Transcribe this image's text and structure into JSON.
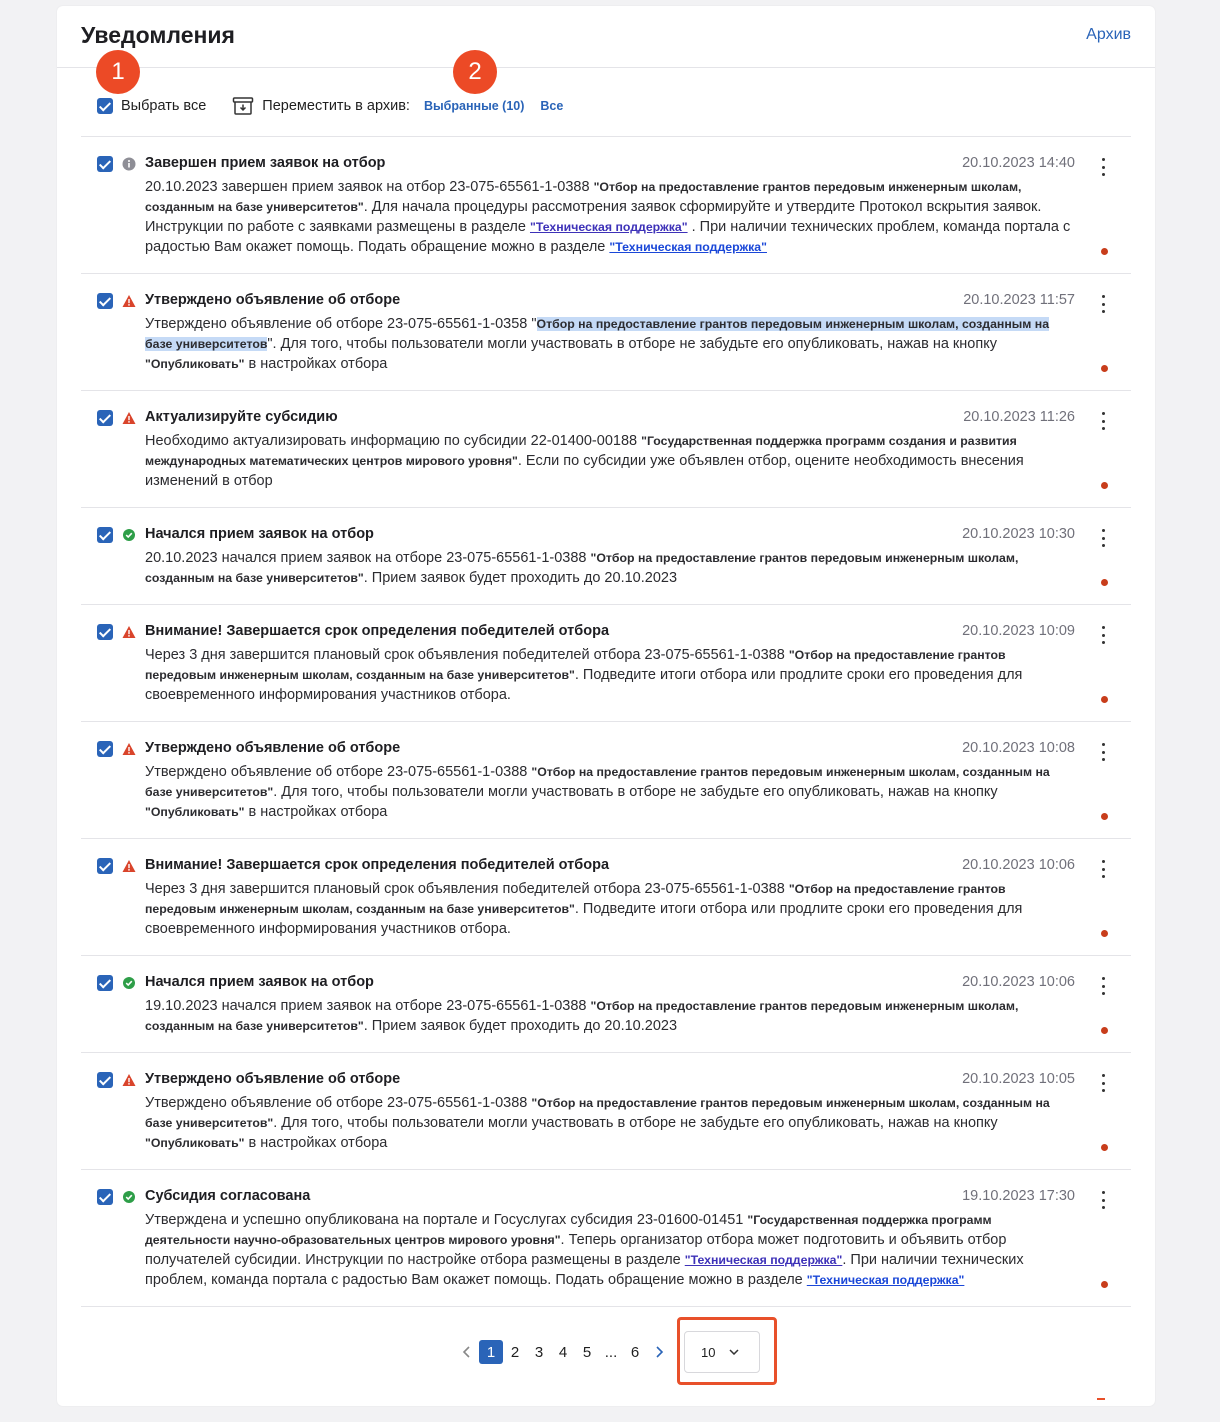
{
  "header": {
    "title": "Уведомления",
    "archive_link": "Архив"
  },
  "markers": [
    "1",
    "2"
  ],
  "toolbar": {
    "select_all": "Выбрать все",
    "move_to_archive": "Переместить в архив:",
    "selected_link": "Выбранные (10)",
    "all_link": "Все"
  },
  "notifications": [
    {
      "type": "info",
      "title": "Завершен прием заявок на отбор",
      "time": "20.10.2023 14:40",
      "checked": true,
      "unread": true,
      "text1": "20.10.2023 завершен прием заявок на отбор 23-075-65561-1-0388 ",
      "bold1": "\"Отбор на предоставление грантов передовым инженерным школам, созданным на базе университетов\"",
      "text2": ". Для начала процедуры рассмотрения заявок сформируйте и утвердите Протокол вскрытия заявок. Инструкции по работе с заявками размещены в разделе ",
      "link1": "\"Техническая поддержка\"",
      "text3": " . При наличии технических проблем, команда портала с радостью Вам окажет помощь. Подать обращение можно в разделе  ",
      "link2": "\"Техническая поддержка\""
    },
    {
      "type": "warning",
      "title": "Утверждено объявление об отборе",
      "time": "20.10.2023 11:57",
      "checked": true,
      "unread": true,
      "text1": "Утверждено объявление об отборе 23-075-65561-1-0358 \"",
      "bold1": "Отбор на предоставление грантов передовым инженерным школам, созданным на базе университетов",
      "text2": "\". Для того, чтобы пользователи могли участвовать в отборе не забудьте его опубликовать, нажав на кнопку ",
      "bold2": "\"Опубликовать\"",
      "text3": " в настройках отбора"
    },
    {
      "type": "warning",
      "title": "Актуализируйте субсидию",
      "time": "20.10.2023 11:26",
      "checked": true,
      "unread": true,
      "text1": "Необходимо актуализировать информацию по субсидии 22-01400-00188 ",
      "bold1": "\"Государственная поддержка программ создания и развития международных математических центров мирового уровня\"",
      "text2": ". Если по субсидии уже объявлен отбор, оцените необходимость внесения изменений в отбор"
    },
    {
      "type": "success",
      "title": "Начался прием заявок на отбор",
      "time": "20.10.2023 10:30",
      "checked": true,
      "unread": true,
      "text1": "20.10.2023 начался прием заявок на отборе 23-075-65561-1-0388 ",
      "bold1": "\"Отбор на предоставление грантов передовым инженерным школам, созданным на базе университетов\"",
      "text2": ". Прием заявок будет проходить до 20.10.2023"
    },
    {
      "type": "warning",
      "title": "Внимание! Завершается срок определения победителей отбора",
      "time": "20.10.2023 10:09",
      "checked": true,
      "unread": true,
      "text1": "Через 3 дня завершится плановый срок объявления победителей отбора 23-075-65561-1-0388 ",
      "bold1": "\"Отбор на предоставление грантов передовым инженерным школам, созданным на базе университетов\"",
      "text2": ". Подведите итоги отбора или продлите сроки его проведения для своевременного информирования участников отбора."
    },
    {
      "type": "warning",
      "title": "Утверждено объявление об отборе",
      "time": "20.10.2023 10:08",
      "checked": true,
      "unread": true,
      "text1": "Утверждено объявление об отборе 23-075-65561-1-0388 ",
      "bold1": "\"Отбор на предоставление грантов передовым инженерным школам, созданным на базе университетов\"",
      "text2": ". Для того, чтобы пользователи могли участвовать в отборе не забудьте его опубликовать, нажав на кнопку ",
      "bold2": "\"Опубликовать\"",
      "text3": " в настройках отбора"
    },
    {
      "type": "warning",
      "title": "Внимание! Завершается срок определения победителей отбора",
      "time": "20.10.2023 10:06",
      "checked": true,
      "unread": true,
      "text1": "Через 3 дня завершится плановый срок объявления победителей отбора 23-075-65561-1-0388 ",
      "bold1": "\"Отбор на предоставление грантов передовым инженерным школам, созданным на базе университетов\"",
      "text2": ". Подведите итоги отбора или продлите сроки его проведения для своевременного информирования участников отбора."
    },
    {
      "type": "success",
      "title": "Начался прием заявок на отбор",
      "time": "20.10.2023 10:06",
      "checked": true,
      "unread": true,
      "text1": "19.10.2023 начался прием заявок на отборе 23-075-65561-1-0388 ",
      "bold1": "\"Отбор на предоставление грантов передовым инженерным школам, созданным на базе университетов\"",
      "text2": ". Прием заявок будет проходить до 20.10.2023"
    },
    {
      "type": "warning",
      "title": "Утверждено объявление об отборе",
      "time": "20.10.2023 10:05",
      "checked": true,
      "unread": true,
      "text1": "Утверждено объявление об отборе 23-075-65561-1-0388 ",
      "bold1": "\"Отбор на предоставление грантов передовым инженерным школам, созданным на базе университетов\"",
      "text2": ". Для того, чтобы пользователи могли участвовать в отборе не забудьте его опубликовать, нажав на кнопку ",
      "bold2": "\"Опубликовать\"",
      "text3": " в настройках отбора"
    },
    {
      "type": "success",
      "title": "Субсидия согласована",
      "time": "19.10.2023 17:30",
      "checked": true,
      "unread": true,
      "text1": "Утверждена и успешно опубликована на портале и Госуслугах субсидия 23-01600-01451 ",
      "bold1": "\"Государственная поддержка программ деятельности научно-образовательных центров мирового уровня\"",
      "text2": ". Теперь организатор отбора может подготовить и объявить отбор получателей субсидии. Инструкции по настройке отбора размещены в разделе ",
      "link1": "\"Техническая поддержка\"",
      "text3": ". При наличии технических проблем, команда портала с радостью Вам окажет помощь. Подать обращение можно в разделе ",
      "link2": "\"Техническая поддержка\""
    }
  ],
  "pagination": {
    "pages": [
      "1",
      "2",
      "3",
      "4",
      "5",
      "...",
      "6"
    ],
    "current": "1",
    "per_page": "10"
  },
  "colors": {
    "accent": "#2a64b8",
    "marker": "#ec4a26",
    "warning": "#d9442b",
    "success": "#2e9e48",
    "info": "#8e8e96",
    "unread": "#c83d1b"
  }
}
